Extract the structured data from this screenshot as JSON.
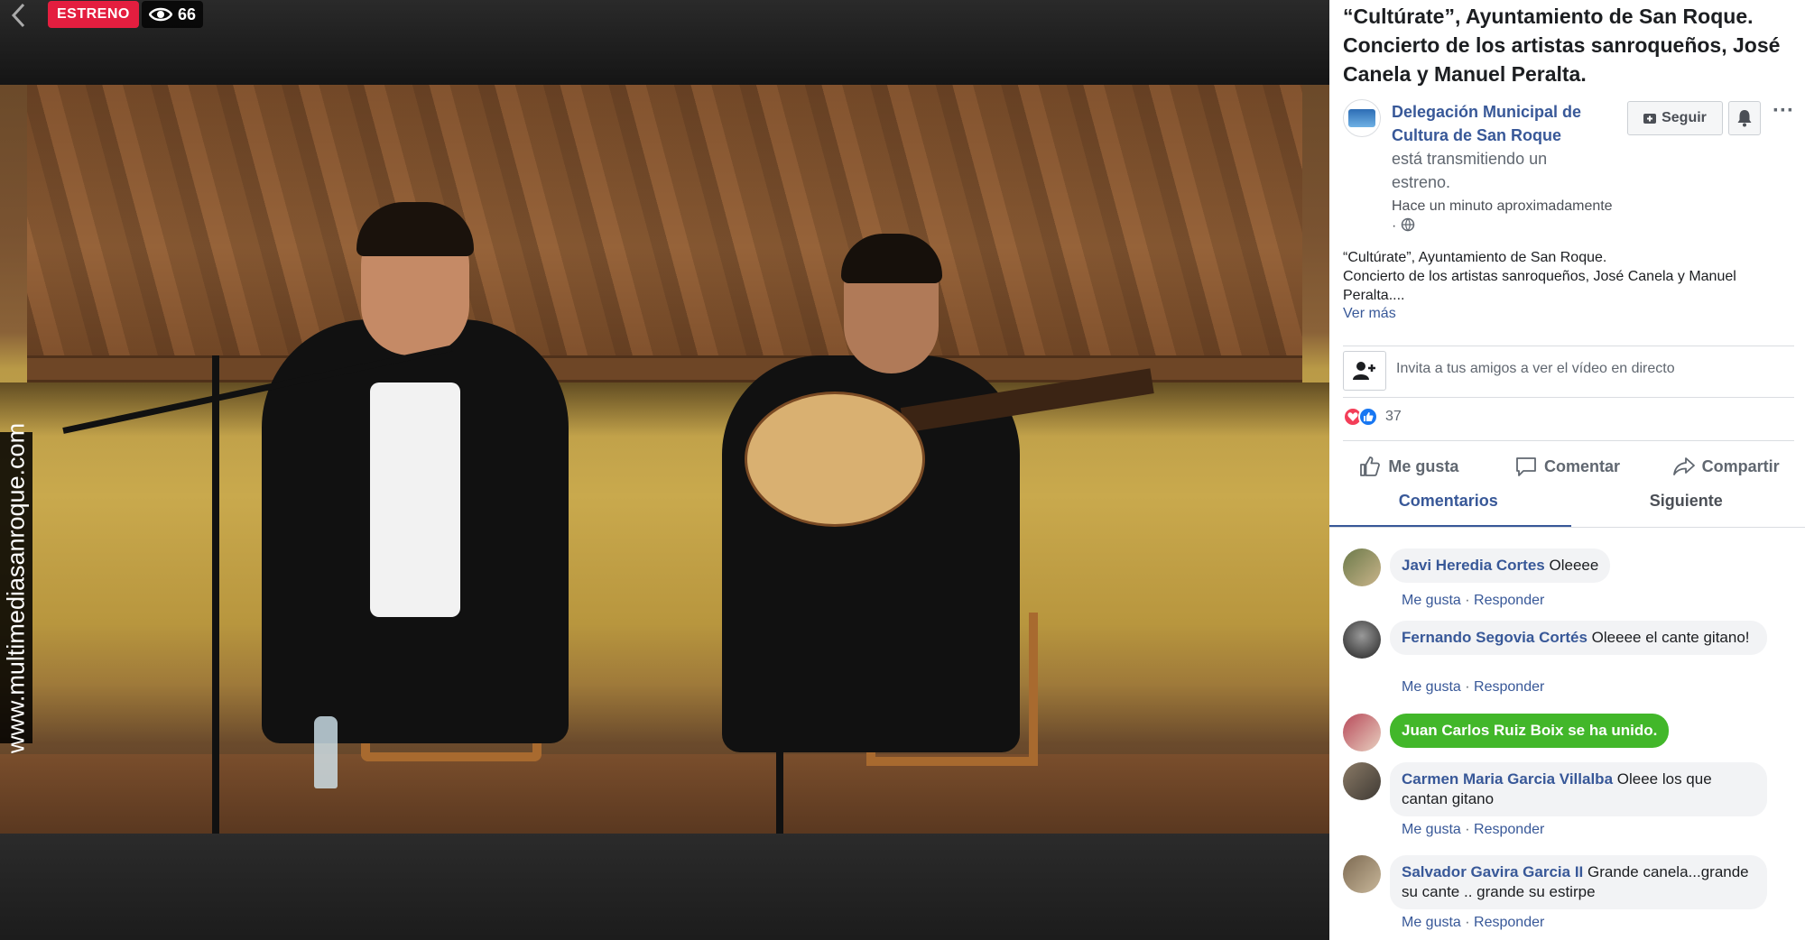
{
  "video": {
    "badge_label": "ESTRENO",
    "view_count": "66",
    "watermark": "www.multimediasanroque.com"
  },
  "post": {
    "title": "“Cultúrate”, Ayuntamiento de San Roque. Concierto de los artistas sanroqueños, José Canela y Manuel Peralta.",
    "page_name": "Delegación Municipal de Cultura de San Roque",
    "activity": "está transmitiendo un estreno.",
    "timestamp": "Hace un minuto aproximadamente",
    "timestamp_sep": "·",
    "follow_label": "Seguir",
    "more_label": "···",
    "description_line1": "“Cultúrate”, Ayuntamiento de San Roque.",
    "description_line2": "Concierto de los artistas sanroqueños, José Canela y Manuel Peralta....",
    "see_more": "Ver más"
  },
  "invite": {
    "text": "Invita a tus amigos a ver el vídeo en directo"
  },
  "reactions": {
    "count": "37"
  },
  "actions": {
    "like": "Me gusta",
    "comment": "Comentar",
    "share": "Compartir"
  },
  "tabs": {
    "comments": "Comentarios",
    "next": "Siguiente"
  },
  "comment_actions": {
    "like": "Me gusta",
    "reply": "Responder",
    "sep": "·"
  },
  "comments": [
    {
      "name": "Javi Heredia Cortes",
      "text": "Oleeee"
    },
    {
      "name": "Fernando Segovia Cortés",
      "text": "Oleeee el cante gitano!"
    },
    {
      "name": "Juan Carlos Ruiz Boix",
      "text": "se ha unido."
    },
    {
      "name": "Carmen Maria Garcia Villalba",
      "text": "Oleee los que cantan gitano"
    },
    {
      "name": "Salvador Gavira Garcia II",
      "text": "Grande canela...grande su cante .. grande su estirpe"
    }
  ],
  "colors": {
    "estreno_red": "#e41e3f",
    "link_blue": "#385898",
    "joined_green": "#42b72a"
  }
}
